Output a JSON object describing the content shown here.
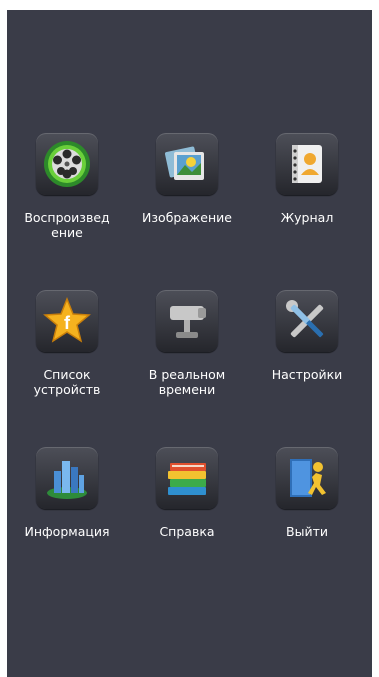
{
  "menu": {
    "row1": [
      {
        "label": "Воспроизвед\nение",
        "icon": "film-reel-icon"
      },
      {
        "label": "Изображение",
        "icon": "photos-icon"
      },
      {
        "label": "Журнал",
        "icon": "contacts-book-icon"
      }
    ],
    "row2": [
      {
        "label": "Список\nустройств",
        "icon": "star-favorite-icon"
      },
      {
        "label": "В реальном\nвремени",
        "icon": "cctv-camera-icon"
      },
      {
        "label": "Настройки",
        "icon": "wrench-screwdriver-icon"
      }
    ],
    "row3": [
      {
        "label": "Информация",
        "icon": "city-buildings-icon"
      },
      {
        "label": "Справка",
        "icon": "books-icon"
      },
      {
        "label": "Выйти",
        "icon": "exit-door-icon"
      }
    ]
  },
  "colors": {
    "background": "#3a3c48",
    "text": "#ffffff"
  }
}
